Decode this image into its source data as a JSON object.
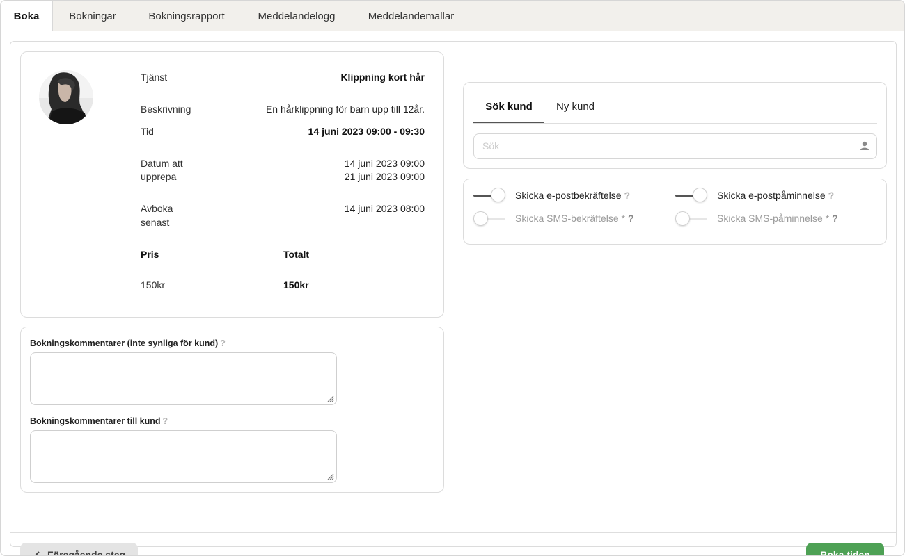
{
  "tabs": [
    {
      "label": "Boka",
      "active": true
    },
    {
      "label": "Bokningar"
    },
    {
      "label": "Bokningsrapport"
    },
    {
      "label": "Meddelandelogg"
    },
    {
      "label": "Meddelandemallar"
    }
  ],
  "booking": {
    "service_label": "Tjänst",
    "service_value": "Klippning kort hår",
    "description_label": "Beskrivning",
    "description_value": "En hårklippning för barn upp till 12år.",
    "time_label": "Tid",
    "time_value": "14 juni 2023 09:00 - 09:30",
    "repeat_label_1": "Datum att",
    "repeat_label_2": "upprepa",
    "repeat_dates": [
      "14 juni 2023 09:00",
      "21 juni 2023 09:00"
    ],
    "cancel_label_1": "Avboka",
    "cancel_label_2": "senast",
    "cancel_value": "14 juni 2023 08:00",
    "price_header": "Pris",
    "total_header": "Totalt",
    "price_value": "150kr",
    "total_value": "150kr"
  },
  "comments": {
    "internal_label": "Bokningskommentarer (inte synliga för kund)",
    "customer_label": "Bokningskommentarer till kund",
    "help": "?"
  },
  "customer": {
    "tabs": [
      "Sök kund",
      "Ny kund"
    ],
    "search_placeholder": "Sök"
  },
  "notifications": {
    "email_confirmation": "Skicka e-postbekräftelse",
    "email_reminder": "Skicka e-postpåminnelse",
    "sms_confirmation": "Skicka SMS-bekräftelse *",
    "sms_reminder": "Skicka SMS-påminnelse *",
    "help": "?",
    "states": {
      "email_confirmation": true,
      "email_reminder": true,
      "sms_confirmation": false,
      "sms_reminder": false
    }
  },
  "footer": {
    "prev_label": "Föregående steg",
    "book_label": "Boka tiden"
  },
  "colors": {
    "accent_green": "#4ea155",
    "tab_bg": "#f2f0ec"
  }
}
